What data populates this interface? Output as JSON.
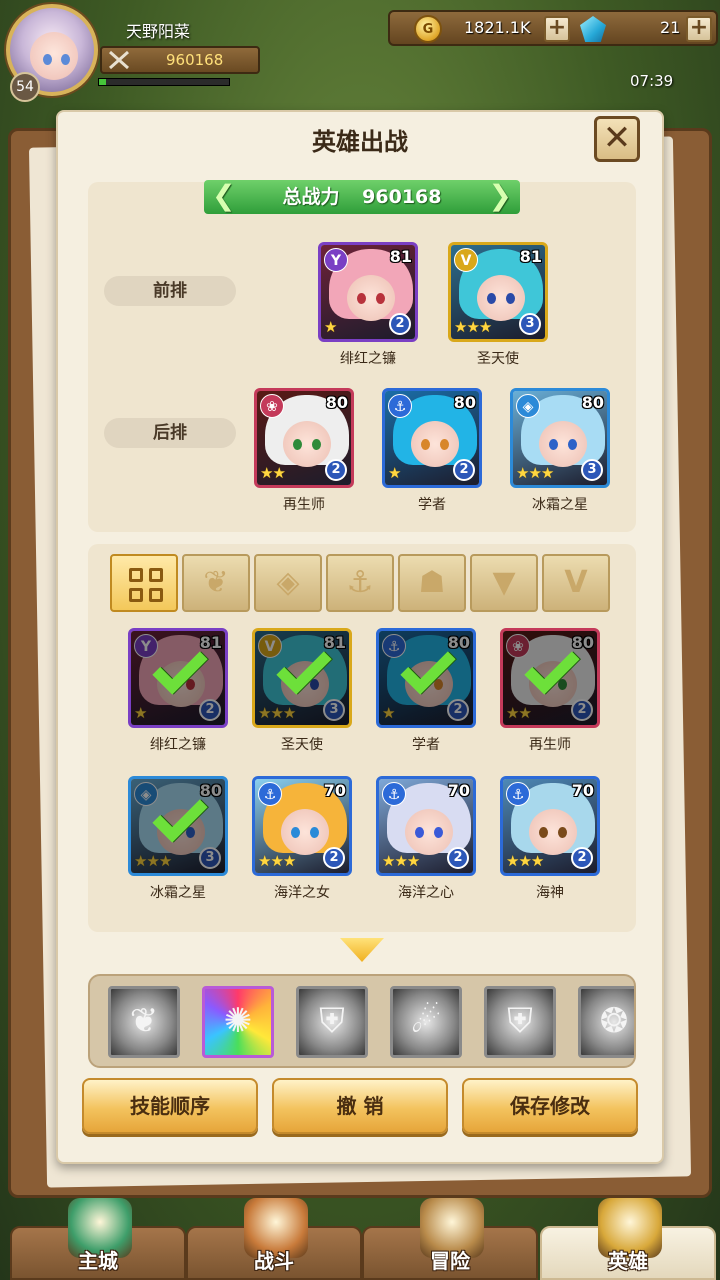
{
  "player": {
    "name": "天野阳菜",
    "level": "54",
    "power": "960168",
    "exp_fraction": 0.05
  },
  "currency": {
    "gold": "1821.1K",
    "gold_icon": "G",
    "gems": "21",
    "plus": "+"
  },
  "clock": "07:39",
  "panel": {
    "title": "英雄出战",
    "close": "✕",
    "total_power_label": "总战力",
    "total_power": "960168",
    "arrow_left": "❮",
    "arrow_right": "❯"
  },
  "rows": {
    "front": "前排",
    "back": "后排"
  },
  "formation": {
    "front": [
      {
        "name": "绯红之镰",
        "level": "81",
        "tier": "2",
        "stars": "★",
        "class_icon": "Y",
        "class_color": "#7a3fc4",
        "hair": "#f2a6b8",
        "eyes": "#b8323c",
        "bg": "#6e2238"
      },
      {
        "name": "圣天使",
        "level": "81",
        "tier": "3",
        "stars": "★★★",
        "class_icon": "V",
        "class_color": "#d9a81a",
        "hair": "#3fc6d8",
        "eyes": "#2a4aa8",
        "bg": "#2c6e8e"
      }
    ],
    "back": [
      {
        "name": "再生师",
        "level": "80",
        "tier": "2",
        "stars": "★★",
        "class_icon": "❀",
        "class_color": "#c43a5a",
        "hair": "#eeeeee",
        "eyes": "#2e8a3a",
        "bg": "#5a1a14"
      },
      {
        "name": "学者",
        "level": "80",
        "tier": "2",
        "stars": "★",
        "class_icon": "⚓",
        "class_color": "#2c6ad8",
        "hair": "#22b4e6",
        "eyes": "#d8862a",
        "bg": "#1a6ea8"
      },
      {
        "name": "冰霜之星",
        "level": "80",
        "tier": "3",
        "stars": "★★★",
        "class_icon": "◈",
        "class_color": "#2c8ad8",
        "hair": "#a8dcf4",
        "eyes": "#2c62c8",
        "bg": "#6ab0d8"
      }
    ]
  },
  "filters": [
    {
      "name": "all",
      "symbol": ""
    },
    {
      "name": "sprout",
      "symbol": "❦"
    },
    {
      "name": "diamond",
      "symbol": "◈"
    },
    {
      "name": "anchor",
      "symbol": "⚓"
    },
    {
      "name": "beast",
      "symbol": "☗"
    },
    {
      "name": "fox",
      "symbol": "▼"
    },
    {
      "name": "wings",
      "symbol": "V"
    }
  ],
  "roster": [
    {
      "name": "绯红之镰",
      "level": "81",
      "tier": "2",
      "stars": "★",
      "selected": true,
      "class_icon": "Y",
      "class_color": "#7a3fc4",
      "hair": "#f2a6b8",
      "eyes": "#b8323c",
      "bg": "#6e2238"
    },
    {
      "name": "圣天使",
      "level": "81",
      "tier": "3",
      "stars": "★★★",
      "selected": true,
      "class_icon": "V",
      "class_color": "#d9a81a",
      "hair": "#3fc6d8",
      "eyes": "#2a4aa8",
      "bg": "#2c6e8e"
    },
    {
      "name": "学者",
      "level": "80",
      "tier": "2",
      "stars": "★",
      "selected": true,
      "class_icon": "⚓",
      "class_color": "#2c6ad8",
      "hair": "#22b4e6",
      "eyes": "#d8862a",
      "bg": "#1a6ea8"
    },
    {
      "name": "再生师",
      "level": "80",
      "tier": "2",
      "stars": "★★",
      "selected": true,
      "class_icon": "❀",
      "class_color": "#c43a5a",
      "hair": "#eeeeee",
      "eyes": "#2e8a3a",
      "bg": "#5a1a14"
    },
    {
      "name": "冰霜之星",
      "level": "80",
      "tier": "3",
      "stars": "★★★",
      "selected": true,
      "class_icon": "◈",
      "class_color": "#2c8ad8",
      "hair": "#a8dcf4",
      "eyes": "#2c62c8",
      "bg": "#6ab0d8"
    },
    {
      "name": "海洋之女",
      "level": "70",
      "tier": "2",
      "stars": "★★★",
      "selected": false,
      "class_icon": "⚓",
      "class_color": "#2c6ad8",
      "hair": "#f6b43a",
      "eyes": "#2a8ad8",
      "bg": "#8ad0f0"
    },
    {
      "name": "海洋之心",
      "level": "70",
      "tier": "2",
      "stars": "★★★",
      "selected": false,
      "class_icon": "⚓",
      "class_color": "#2c6ad8",
      "hair": "#d8dcf2",
      "eyes": "#3a5ad8",
      "bg": "#7ea8d8"
    },
    {
      "name": "海神",
      "level": "70",
      "tier": "2",
      "stars": "★★★",
      "selected": false,
      "class_icon": "⚓",
      "class_color": "#2c6ad8",
      "hair": "#a8d8ec",
      "eyes": "#7a4a1a",
      "bg": "#4e8ab8"
    }
  ],
  "skills": [
    {
      "name": "wing-skill",
      "glyph": "❦",
      "color": "gray"
    },
    {
      "name": "rainbow-burst-skill",
      "glyph": "✺",
      "color": "color"
    },
    {
      "name": "shield-skill",
      "glyph": "⛨",
      "color": "gray"
    },
    {
      "name": "strike-skill",
      "glyph": "☄",
      "color": "gray"
    },
    {
      "name": "guard-skill",
      "glyph": "⛨",
      "color": "gray"
    },
    {
      "name": "wave-skill",
      "glyph": "❂",
      "color": "gray"
    }
  ],
  "buttons": {
    "skill_order": "技能顺序",
    "undo": "撤 销",
    "save": "保存修改"
  },
  "nav": [
    {
      "label": "主城",
      "icon": "castle-icon",
      "active": false,
      "color": "#3e9e6a"
    },
    {
      "label": "战斗",
      "icon": "crossed-swords-icon",
      "active": false,
      "color": "#c87a3a"
    },
    {
      "label": "冒险",
      "icon": "scroll-map-icon",
      "active": false,
      "color": "#b88a4a"
    },
    {
      "label": "英雄",
      "icon": "hero-crest-icon",
      "active": true,
      "color": "#d8a83a"
    }
  ]
}
